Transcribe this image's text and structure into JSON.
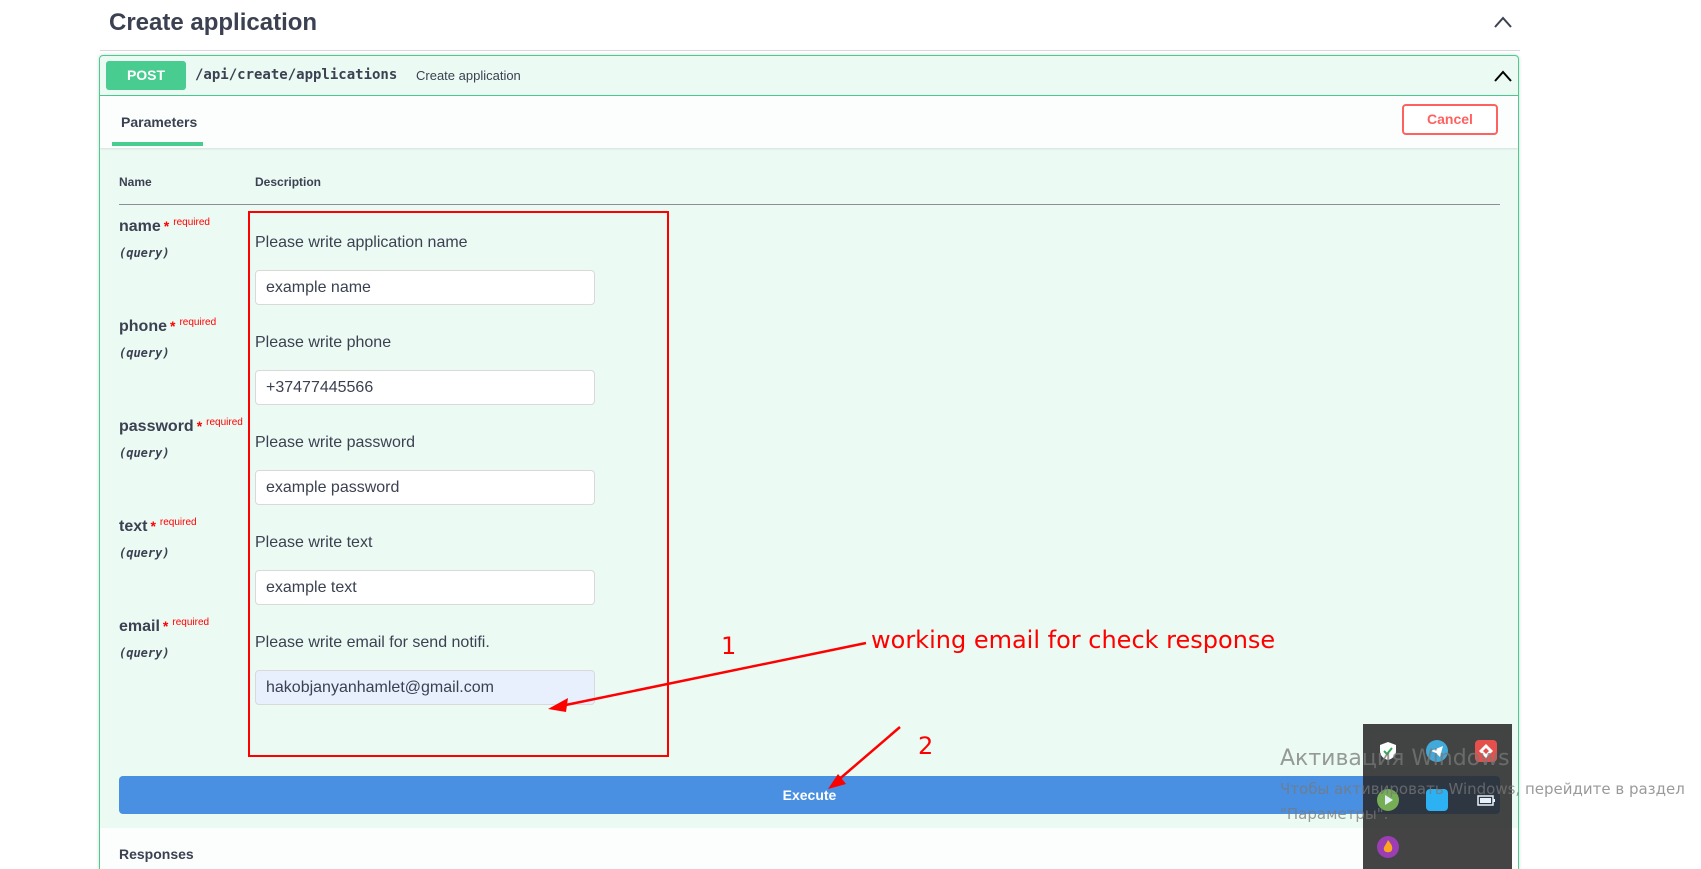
{
  "section": {
    "title": "Create application"
  },
  "operation": {
    "method": "POST",
    "path": "/api/create/applications",
    "summary": "Create application"
  },
  "params_tab": {
    "label": "Parameters",
    "cancel_label": "Cancel"
  },
  "columns": {
    "name": "Name",
    "description": "Description"
  },
  "params": [
    {
      "name": "name",
      "star": "*",
      "required": "required",
      "in": "(query)",
      "description": "Please write application name",
      "value": "example name"
    },
    {
      "name": "phone",
      "star": "*",
      "required": "required",
      "in": "(query)",
      "description": "Please write phone",
      "value": "+37477445566"
    },
    {
      "name": "password",
      "star": "*",
      "required": "required",
      "in": "(query)",
      "description": "Please write password",
      "value": "example password"
    },
    {
      "name": "text",
      "star": "*",
      "required": "required",
      "in": "(query)",
      "description": "Please write text",
      "value": "example text"
    },
    {
      "name": "email",
      "star": "*",
      "required": "required",
      "in": "(query)",
      "description": "Please write email for send notifi.",
      "value": "hakobjanyanhamlet@gmail.com"
    }
  ],
  "execute_label": "Execute",
  "responses_label": "Responses",
  "annotations": {
    "step1": "1",
    "note": "working email for check response",
    "step2": "2",
    "color": "#ff0000"
  },
  "windows_watermark": {
    "line1": "Активация Windows",
    "line2": "Чтобы активировать Windows, перейдите в раздел",
    "line3": "\"Параметры\"."
  },
  "colors": {
    "post_green": "#49cc90",
    "execute_blue": "#4990e2",
    "cancel_red": "#ff6060"
  }
}
